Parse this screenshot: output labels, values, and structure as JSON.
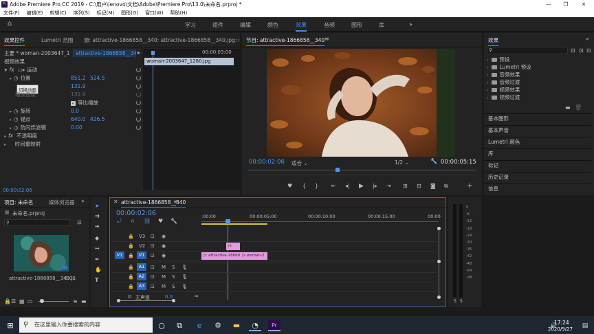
{
  "window": {
    "title": "Adobe Premiere Pro CC 2019 - C:\\用户\\lenovo\\文档\\Adobe\\Premiere Pro\\13.0\\未命名.prproj *",
    "app_icon": "Pr"
  },
  "menu": [
    "文件(F)",
    "编辑(E)",
    "剪辑(C)",
    "序列(S)",
    "标记(M)",
    "图形(G)",
    "窗口(W)",
    "帮助(H)"
  ],
  "workspaces": [
    "学习",
    "组件",
    "编辑",
    "颜色",
    "效果",
    "音频",
    "图形",
    "库"
  ],
  "active_workspace": "效果",
  "effect_controls": {
    "tabs": [
      "效果控件",
      "Lumetri 范围",
      "源: attractive-1866858__340: attractive-1866858__340.jpg: 00:00:00:00"
    ],
    "active_tab": "效果控件",
    "source_label": "主要 * woman-2003647_1280...",
    "sequence_label": "attractive-1866858__340 *",
    "mini_time": "00:00:03:00",
    "mini_clip": "woman-2003647_1280.jpg",
    "video_effects": "视频效果",
    "motion": "运动",
    "position_label": "位置",
    "position_x": "851.2",
    "position_y": "524.5",
    "tooltip": "切换动画",
    "scale_value": "131.9",
    "scale_width_label": "缩放宽度",
    "scale_width_value": "131.9",
    "uniform_scale": "等比缩放",
    "rotation_label": "旋转",
    "rotation_value": "0.0",
    "anchor_label": "锚点",
    "anchor_x": "640.0",
    "anchor_y": "426.5",
    "antiflicker_label": "防闪烁滤镜",
    "antiflicker_value": "0.00",
    "opacity_label": "不透明度",
    "time_remap_label": "时间重映射",
    "timecode": "00:00:02:06"
  },
  "program_monitor": {
    "title": "节目: attractive-1866858__340",
    "timecode": "00:00:02:06",
    "fit": "适合",
    "resolution": "1/2",
    "duration": "00:00:05:15"
  },
  "project": {
    "tabs": [
      "项目: 未命名",
      "媒体浏览器"
    ],
    "file": "未命名.prproj",
    "clip_name": "attractive-1866858__340.j...",
    "clip_duration": "5:00"
  },
  "timeline": {
    "tab": "attractive-1866858__340",
    "timecode": "00:00:02:06",
    "ruler": [
      ":00:00",
      "00:00:05:00",
      "00:00:10:00",
      "00:00:15:00",
      "00:00"
    ],
    "tracks": [
      "V3",
      "V2",
      "V1",
      "A1",
      "A2",
      "A3"
    ],
    "source_patch": "V1",
    "master_label": "主声道",
    "master_value": "0.0",
    "clip1": "attractive-1866858",
    "clip2": "woman-2",
    "meter_scale": [
      "0",
      "-6",
      "-12",
      "-18",
      "-24",
      "-30",
      "-36",
      "-42",
      "-48",
      "-54",
      "-dB"
    ],
    "meter_solo": "S"
  },
  "effects_panel": {
    "title": "效果",
    "folders": [
      "预设",
      "Lumetri 预设",
      "音频效果",
      "音频过渡",
      "视频效果",
      "视频过渡"
    ],
    "sections": [
      "基本图形",
      "基本声音",
      "Lumetri 颜色",
      "库",
      "标记",
      "历史记录",
      "信息"
    ]
  },
  "taskbar": {
    "search_placeholder": "在这里输入你要搜索的内容",
    "time": "17:24",
    "date": "2020/9/27"
  }
}
